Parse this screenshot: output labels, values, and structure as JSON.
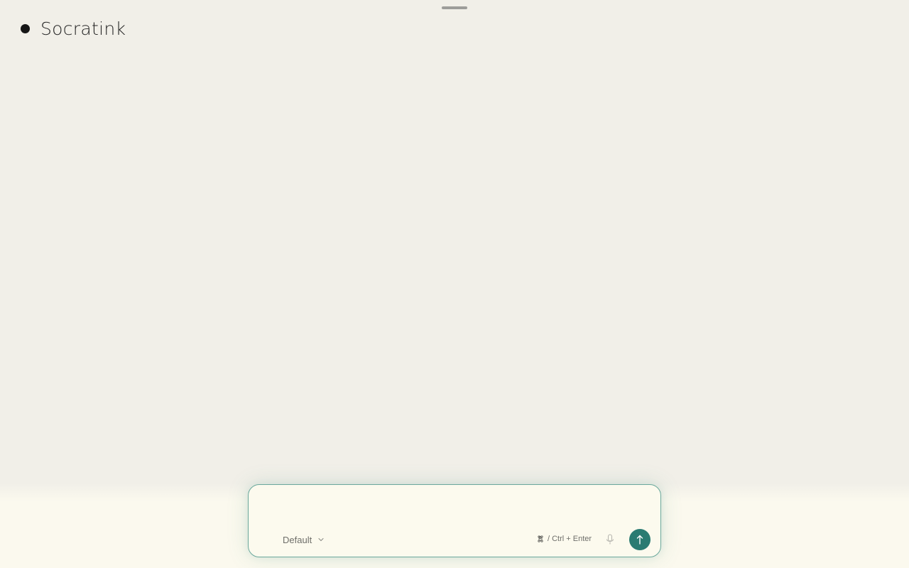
{
  "app": {
    "name": "Socratink"
  },
  "composer": {
    "placeholder": "",
    "value": "",
    "mode_label": "Default",
    "shortcut_hint": "/ Ctrl + Enter",
    "icons": {
      "mode": "chevron-down-icon",
      "shortcut": "command-key-icon",
      "mic": "microphone-icon",
      "send": "arrow-up-icon"
    }
  },
  "colors": {
    "background": "#f1efe8",
    "composer_bg": "#fcfaee",
    "composer_border": "#6aa89c",
    "accent": "#2a7b72",
    "brand_dot": "#161616"
  }
}
